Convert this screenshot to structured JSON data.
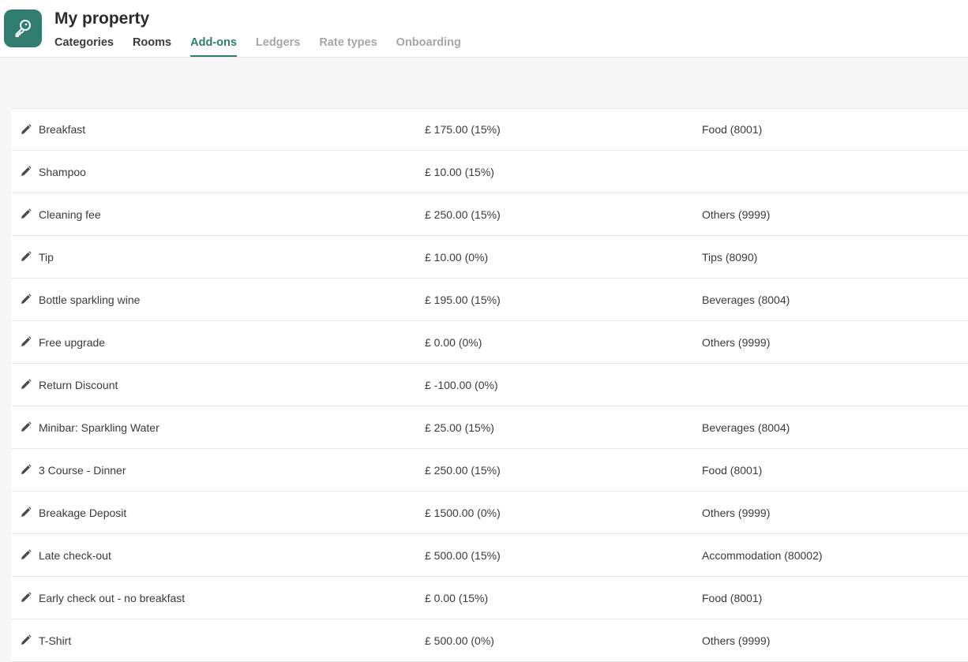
{
  "app": {
    "title": "My property",
    "logo_icon": "key-icon",
    "accent_color": "#2e7d6f"
  },
  "tabs": [
    {
      "label": "Categories",
      "state": "default"
    },
    {
      "label": "Rooms",
      "state": "default"
    },
    {
      "label": "Add-ons",
      "state": "active"
    },
    {
      "label": "Ledgers",
      "state": "muted"
    },
    {
      "label": "Rate types",
      "state": "muted"
    },
    {
      "label": "Onboarding",
      "state": "muted"
    }
  ],
  "addons": {
    "row_icon": "pencil-icon",
    "rows": [
      {
        "name": "Breakfast",
        "price": "£ 175.00 (15%)",
        "ledger": "Food (8001)"
      },
      {
        "name": "Shampoo",
        "price": "£ 10.00 (15%)",
        "ledger": ""
      },
      {
        "name": "Cleaning fee",
        "price": "£ 250.00 (15%)",
        "ledger": "Others (9999)"
      },
      {
        "name": "Tip",
        "price": "£ 10.00 (0%)",
        "ledger": "Tips (8090)"
      },
      {
        "name": "Bottle sparkling wine",
        "price": "£ 195.00 (15%)",
        "ledger": "Beverages (8004)"
      },
      {
        "name": "Free upgrade",
        "price": "£ 0.00 (0%)",
        "ledger": "Others (9999)"
      },
      {
        "name": "Return Discount",
        "price": "£ -100.00 (0%)",
        "ledger": ""
      },
      {
        "name": "Minibar: Sparkling Water",
        "price": "£ 25.00 (15%)",
        "ledger": "Beverages (8004)"
      },
      {
        "name": "3 Course - Dinner",
        "price": "£ 250.00 (15%)",
        "ledger": "Food (8001)"
      },
      {
        "name": "Breakage Deposit",
        "price": "£ 1500.00 (0%)",
        "ledger": "Others (9999)"
      },
      {
        "name": "Late check-out",
        "price": "£ 500.00 (15%)",
        "ledger": "Accommodation (80002)"
      },
      {
        "name": "Early check out - no breakfast",
        "price": "£ 0.00 (15%)",
        "ledger": "Food (8001)"
      },
      {
        "name": "T-Shirt",
        "price": "£ 500.00 (0%)",
        "ledger": "Others (9999)"
      }
    ]
  }
}
